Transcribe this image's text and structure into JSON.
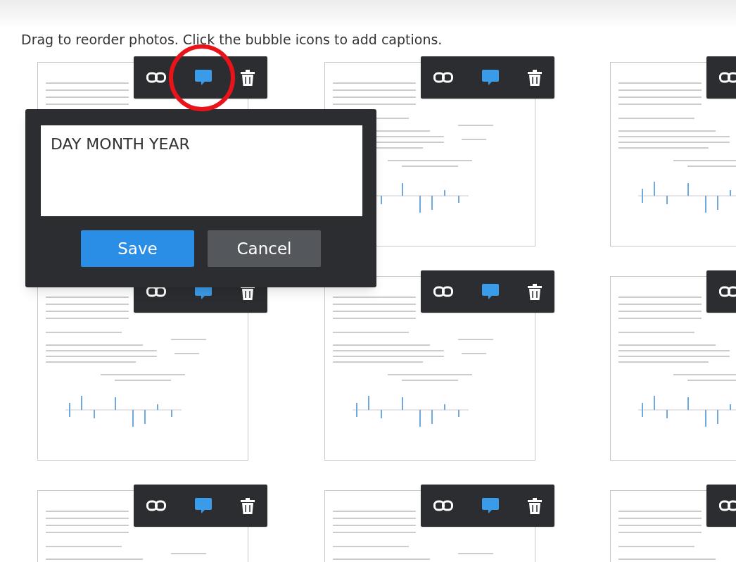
{
  "instruction": "Drag to reorder photos. Click the bubble icons to add captions.",
  "photos": [
    {
      "kind": "document"
    },
    {
      "kind": "document"
    },
    {
      "kind": "document"
    },
    {
      "kind": "document"
    },
    {
      "kind": "document"
    },
    {
      "kind": "document"
    },
    {
      "kind": "document"
    },
    {
      "kind": "document"
    },
    {
      "kind": "document"
    }
  ],
  "caption_editor": {
    "value": "DAY MONTH YEAR",
    "buttons": [
      {
        "label": "Save",
        "kind": "primary"
      },
      {
        "label": "Cancel",
        "kind": "secondary"
      }
    ]
  },
  "annotation": {
    "kind": "circle"
  }
}
